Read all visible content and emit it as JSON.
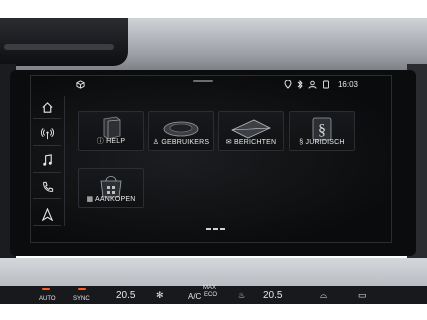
{
  "status_bar": {
    "time": "16:03",
    "icons": [
      "location-icon",
      "bluetooth-icon",
      "user-icon",
      "phone-icon"
    ]
  },
  "sidebar": {
    "items": [
      {
        "name": "home",
        "icon": "home-icon"
      },
      {
        "name": "radio",
        "icon": "radio-icon"
      },
      {
        "name": "media",
        "icon": "music-note-icon"
      },
      {
        "name": "phone",
        "icon": "phone-icon"
      },
      {
        "name": "navigation",
        "icon": "navigation-icon"
      }
    ]
  },
  "tiles": [
    {
      "label": "HELP",
      "icon": "info-icon"
    },
    {
      "label": "GEBRUIKERS",
      "icon": "user-icon"
    },
    {
      "label": "BERICHTEN",
      "icon": "envelope-icon"
    },
    {
      "label": "JURIDISCH",
      "icon": "paragraph-icon"
    },
    {
      "label": "AANKOPEN",
      "icon": "store-icon"
    }
  ],
  "climate": {
    "left_label": "AUTO",
    "sync_label": "SYNC",
    "left_temp": "20.5",
    "max_label": "MAX",
    "eco_label": "ECO",
    "ac_label": "A/C",
    "right_temp": "20.5"
  },
  "colors": {
    "screen_bg": "#0b0c0e",
    "text": "#e9e9e9",
    "led": "#ff5a1f"
  }
}
